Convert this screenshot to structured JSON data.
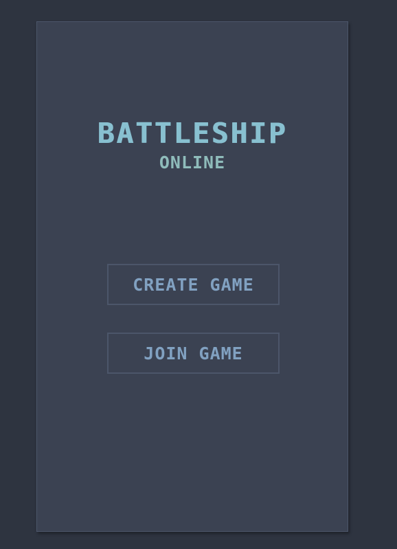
{
  "title": "BATTLESHIP",
  "subtitle": "ONLINE",
  "menu": {
    "create_label": "CREATE GAME",
    "join_label": "JOIN GAME"
  },
  "colors": {
    "background": "#2e3440",
    "panel": "#3b4252",
    "title": "#88c0d0",
    "subtitle": "#8fbcbb",
    "button_text": "#81a1c1",
    "button_border": "#4c566a"
  }
}
